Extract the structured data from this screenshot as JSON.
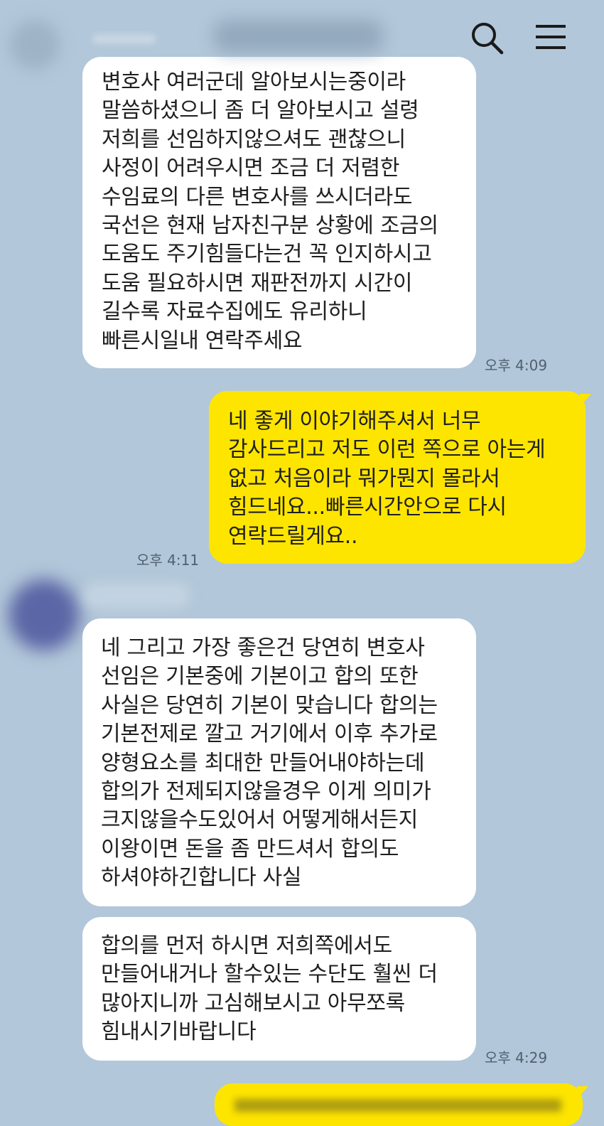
{
  "header": {
    "search_icon": "search-icon",
    "menu_icon": "menu-icon"
  },
  "messages": [
    {
      "id": "msg1",
      "direction": "incoming",
      "text": "변호사 여러군데 알아보시는중이라\n말씀하셨으니 좀 더 알아보시고 설령\n저희를 선임하지않으셔도 괜찮으니\n사정이 어려우시면 조금 더 저렴한\n수임료의 다른 변호사를 쓰시더라도\n국선은 현재 남자친구분 상황에 조금의\n도움도 주기힘들다는건 꼭 인지하시고\n도움 필요하시면 재판전까지 시간이\n길수록 자료수집에도 유리하니\n빠른시일내 연락주세요",
      "time": "오후 4:09"
    },
    {
      "id": "msg2",
      "direction": "outgoing",
      "text": "네 좋게 이야기해주셔서 너무\n감사드리고 저도 이런 쪽으로 아는게\n없고 처음이라 뭐가뭔지 몰라서\n힘드네요...빠른시간안으로 다시\n연락드릴게요..",
      "time": "오후 4:11"
    },
    {
      "id": "msg3",
      "direction": "incoming",
      "text": "네 그리고 가장 좋은건 당연히 변호사\n선임은 기본중에 기본이고 합의 또한\n사실은 당연히 기본이 맞습니다 합의는\n기본전제로 깔고 거기에서 이후 추가로\n양형요소를 최대한 만들어내야하는데\n합의가 전제되지않을경우 이게 의미가\n크지않을수도있어서 어떻게해서든지\n이왕이면 돈을 좀 만드셔서 합의도\n하셔야하긴합니다 사실",
      "time": ""
    },
    {
      "id": "msg4",
      "direction": "incoming",
      "text": "합의를 먼저 하시면 저희쪽에서도\n만들어내거나 할수있는 수단도 훨씬 더\n많아지니까 고심해보시고 아무쪼록\n힘내시기바랍니다",
      "time": "오후 4:29"
    }
  ],
  "colors": {
    "background": "#b2c7d9",
    "incoming_bubble": "#ffffff",
    "outgoing_bubble": "#fee500",
    "time_text": "#50606e"
  }
}
